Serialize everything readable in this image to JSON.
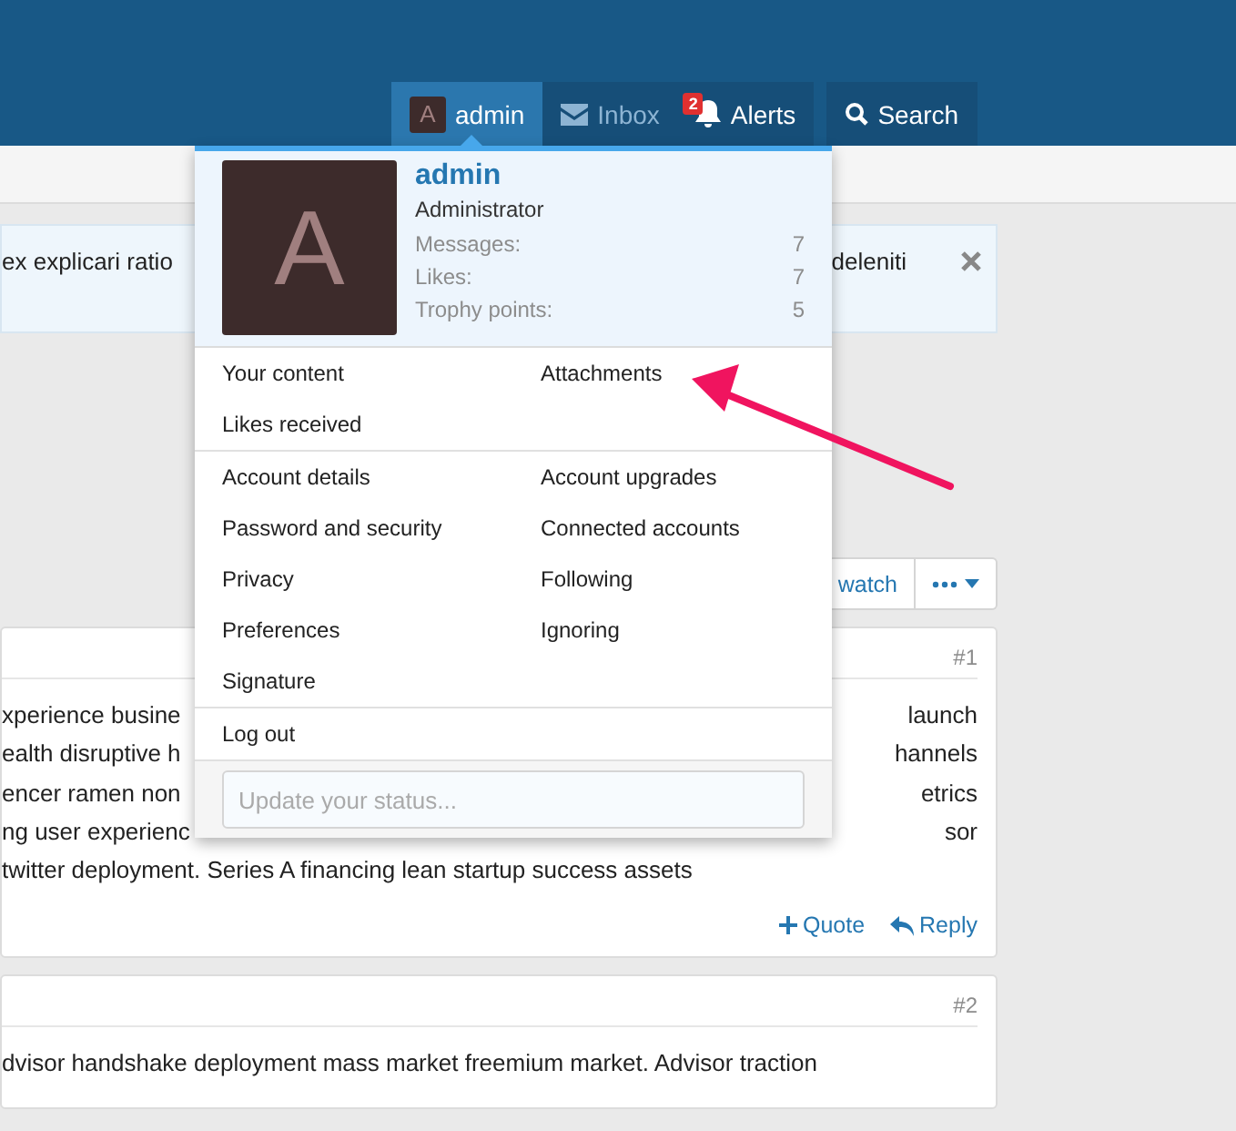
{
  "nav": {
    "items": [
      {
        "kind": "account",
        "label": "admin",
        "avatar_letter": "A",
        "selected": true,
        "dimmed": false
      },
      {
        "kind": "inbox",
        "label": "Inbox",
        "selected": false,
        "dimmed": true
      },
      {
        "kind": "alerts",
        "label": "Alerts",
        "badge": "2",
        "selected": false,
        "dimmed": false
      }
    ],
    "search": {
      "label": "Search"
    }
  },
  "notice": {
    "text_left": "ex explicari ratio",
    "text_right": "deleniti"
  },
  "thread_buttons": {
    "watch": "watch"
  },
  "posts": [
    {
      "number": "#1",
      "lines": [
        {
          "left": "xperience busine",
          "right": "launch"
        },
        {
          "left": "ealth disruptive h",
          "right": "hannels"
        },
        {
          "left": "encer ramen non",
          "right": "etrics"
        },
        {
          "left": "ng user experienc",
          "right": "sor"
        },
        {
          "left": "twitter deployment. Series A financing lean startup success assets"
        }
      ],
      "actions": [
        {
          "kind": "quote",
          "label": "Quote"
        },
        {
          "kind": "reply",
          "label": "Reply"
        }
      ]
    },
    {
      "number": "#2",
      "lines": [
        {
          "left": "dvisor handshake deployment mass market freemium market. Advisor traction"
        }
      ]
    }
  ],
  "account_menu": {
    "avatar_letter": "A",
    "username": "admin",
    "role": "Administrator",
    "stats": [
      {
        "label": "Messages:",
        "value": "7"
      },
      {
        "label": "Likes:",
        "value": "7"
      },
      {
        "label": "Trophy points:",
        "value": "5"
      }
    ],
    "sections": [
      {
        "items": [
          "Your content",
          "Attachments",
          "Likes received"
        ]
      },
      {
        "items": [
          "Account details",
          "Account upgrades",
          "Password and security",
          "Connected accounts",
          "Privacy",
          "Following",
          "Preferences",
          "Ignoring",
          "Signature"
        ]
      },
      {
        "items": [
          "Log out"
        ]
      }
    ],
    "status_placeholder": "Update your status..."
  }
}
